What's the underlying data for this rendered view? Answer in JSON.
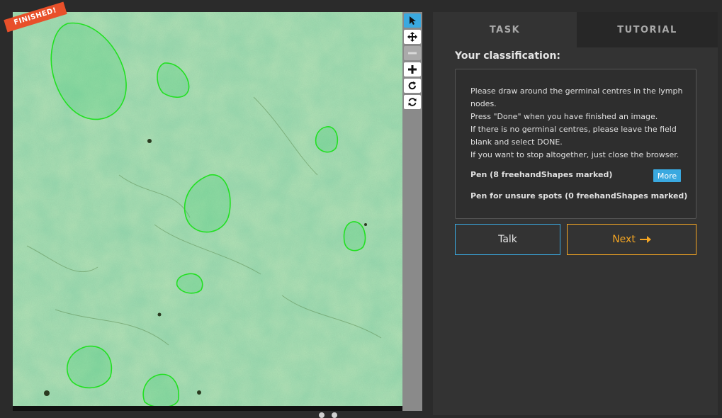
{
  "badge": {
    "finished": "FINISHED!"
  },
  "tabs": [
    {
      "label": "TASK"
    },
    {
      "label": "TUTORIAL"
    }
  ],
  "classification": {
    "title": "Your classification:",
    "instructions": [
      "Please draw around the germinal centres in the lymph",
      "nodes.",
      "Press \"Done\" when you have finished an image.",
      "If there is no germinal centres, please leave the field",
      "blank and select DONE.",
      "If you want to stop altogether, just close the browser."
    ],
    "pen_label": "Pen (8 freehandShapes marked)",
    "more_label": "More",
    "pen_unsure_label": "Pen for unsure spots (0 freehandShapes marked)"
  },
  "buttons": {
    "talk": "Talk",
    "next": "Next"
  },
  "toolbar": {
    "tools": [
      "pointer-icon",
      "move-icon",
      "zoom-out-icon",
      "zoom-in-icon",
      "rotate-icon",
      "reset-icon"
    ]
  },
  "colors": {
    "accent_blue": "#3aa9e0",
    "accent_orange": "#f5a623",
    "badge_red": "#e8502a",
    "outline_green": "#22e022"
  }
}
